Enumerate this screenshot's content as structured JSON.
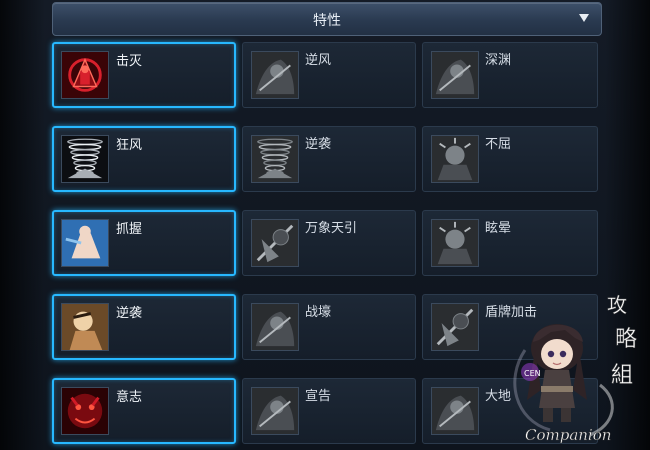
{
  "header": {
    "title": "特性",
    "dropdown_icon": "triangle-down-icon"
  },
  "traits": [
    {
      "row": 1,
      "options": [
        {
          "name": "击灭",
          "selected": true,
          "icon": "crimson-warrior-icon"
        },
        {
          "name": "逆风",
          "selected": false,
          "icon": "grey-fighter-icon"
        },
        {
          "name": "深渊",
          "selected": false,
          "icon": "grey-abyss-icon"
        }
      ]
    },
    {
      "row": 2,
      "options": [
        {
          "name": "狂风",
          "selected": true,
          "icon": "whirlwind-icon"
        },
        {
          "name": "逆袭",
          "selected": false,
          "icon": "grey-whirlwind-icon"
        },
        {
          "name": "不屈",
          "selected": false,
          "icon": "grey-statue-icon"
        }
      ]
    },
    {
      "row": 3,
      "options": [
        {
          "name": "抓握",
          "selected": true,
          "icon": "grab-warrior-icon"
        },
        {
          "name": "万象天引",
          "selected": false,
          "icon": "grey-spear-icon"
        },
        {
          "name": "眩晕",
          "selected": false,
          "icon": "grey-stun-icon"
        }
      ]
    },
    {
      "row": 4,
      "options": [
        {
          "name": "逆袭",
          "selected": true,
          "icon": "counter-warrior-icon"
        },
        {
          "name": "战壕",
          "selected": false,
          "icon": "grey-trench-icon"
        },
        {
          "name": "盾牌加击",
          "selected": false,
          "icon": "grey-shield-bash-icon"
        }
      ]
    },
    {
      "row": 5,
      "options": [
        {
          "name": "意志",
          "selected": true,
          "icon": "red-demon-icon"
        },
        {
          "name": "宣告",
          "selected": false,
          "icon": "grey-proclaim-icon"
        },
        {
          "name": "大地",
          "selected": false,
          "icon": "grey-earth-icon"
        }
      ]
    }
  ],
  "watermark": {
    "text": "Companion",
    "side_text": "攻略組",
    "badge": "CEN"
  }
}
